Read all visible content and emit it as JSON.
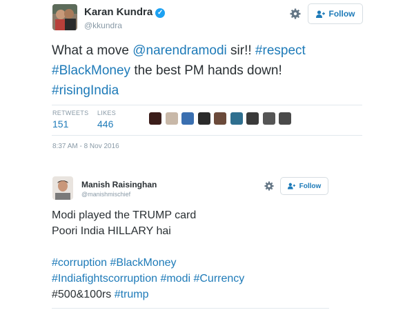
{
  "tweet1": {
    "name": "Karan Kundra",
    "handle": "@kkundra",
    "follow_label": "Follow",
    "line1": {
      "t1": "What a move ",
      "t2": "@narendramodi",
      "t3": " sir!! ",
      "t4": "#respect"
    },
    "line2": {
      "t1": "#BlackMoney",
      "t2": " the best PM hands down!"
    },
    "line3": {
      "t1": "#risingIndia"
    },
    "retweets_label": "RETWEETS",
    "retweets_value": "151",
    "likes_label": "LIKES",
    "likes_value": "446",
    "timestamp": "8:37 AM - 8 Nov 2016",
    "liker_colors": [
      "#3b1d1a",
      "#c8b8a8",
      "#3a6fb0",
      "#2b2b2b",
      "#6b4a3a",
      "#2f6f8f",
      "#3a3a3a",
      "#555555",
      "#4a4a4a"
    ]
  },
  "tweet2": {
    "name": "Manish Raisinghan",
    "handle": "@manishmischief",
    "follow_label": "Follow",
    "line1": "Modi played the TRUMP card",
    "line2": "Poori India HILLARY hai",
    "line3": {
      "t1": "#corruption",
      "t2": "#BlackMoney"
    },
    "line4": {
      "t1": "#Indiafightscorruption",
      "t2": "#modi",
      "t3": "#Currency"
    },
    "line5": {
      "t1": "#500&100rs ",
      "t2": "#trump"
    }
  }
}
